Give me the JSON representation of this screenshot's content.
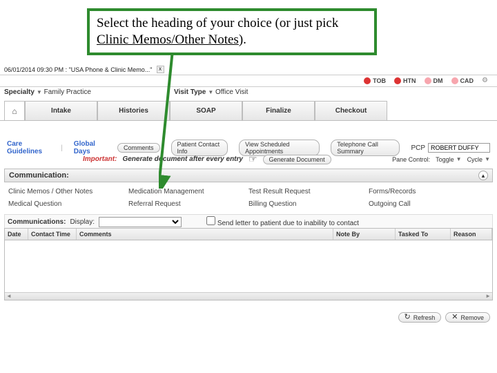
{
  "callout": {
    "pre": "Select the heading of your choice (or just pick ",
    "highlight": "Clinic Memos/Other Notes",
    "post": ")."
  },
  "tab_context": {
    "timestamp": "06/01/2014 09:30 PM : \"USA Phone & Clinic Memo...\""
  },
  "status": {
    "tob": "TOB",
    "htn": "HTN",
    "dm": "DM",
    "cad": "CAD"
  },
  "filters": {
    "specialty_label": "Specialty",
    "specialty_value": "Family Practice",
    "visit_type_label": "Visit Type",
    "visit_type_value": "Office Visit"
  },
  "nav": {
    "home_icon": "⌂",
    "tabs": [
      "Intake",
      "Histories",
      "SOAP",
      "Finalize",
      "Checkout"
    ]
  },
  "links": {
    "care_guidelines": "Care Guidelines",
    "global_days": "Global Days",
    "comments_btn": "Comments",
    "patient_contact": "Patient Contact Info",
    "view_sched": "View Scheduled Appointments",
    "tel_summary": "Telephone Call Summary",
    "pcp_label": "PCP",
    "pcp_value": "ROBERT DUFFY"
  },
  "important": {
    "label": "Important:",
    "msg": "Generate document after every entry",
    "hand": "☞",
    "generate": "Generate Document"
  },
  "pane_control": {
    "label": "Pane Control:",
    "toggle": "Toggle",
    "cycle": "Cycle"
  },
  "communication": {
    "header": "Communication:",
    "headings_r1": [
      "Clinic Memos / Other Notes",
      "Medication Management",
      "Test Result Request",
      "Forms/Records"
    ],
    "headings_r2": [
      "Medical Question",
      "Referral Request",
      "Billing Question",
      "Outgoing Call"
    ],
    "row_label": "Communications:",
    "display_label": "Display:",
    "chk_label": "Send letter to patient due to inability to contact"
  },
  "grid": {
    "cols": [
      "Date",
      "Contact Time",
      "Comments",
      "Note By",
      "Tasked To",
      "Reason"
    ]
  },
  "footer": {
    "refresh": "Refresh",
    "remove": "Remove"
  }
}
